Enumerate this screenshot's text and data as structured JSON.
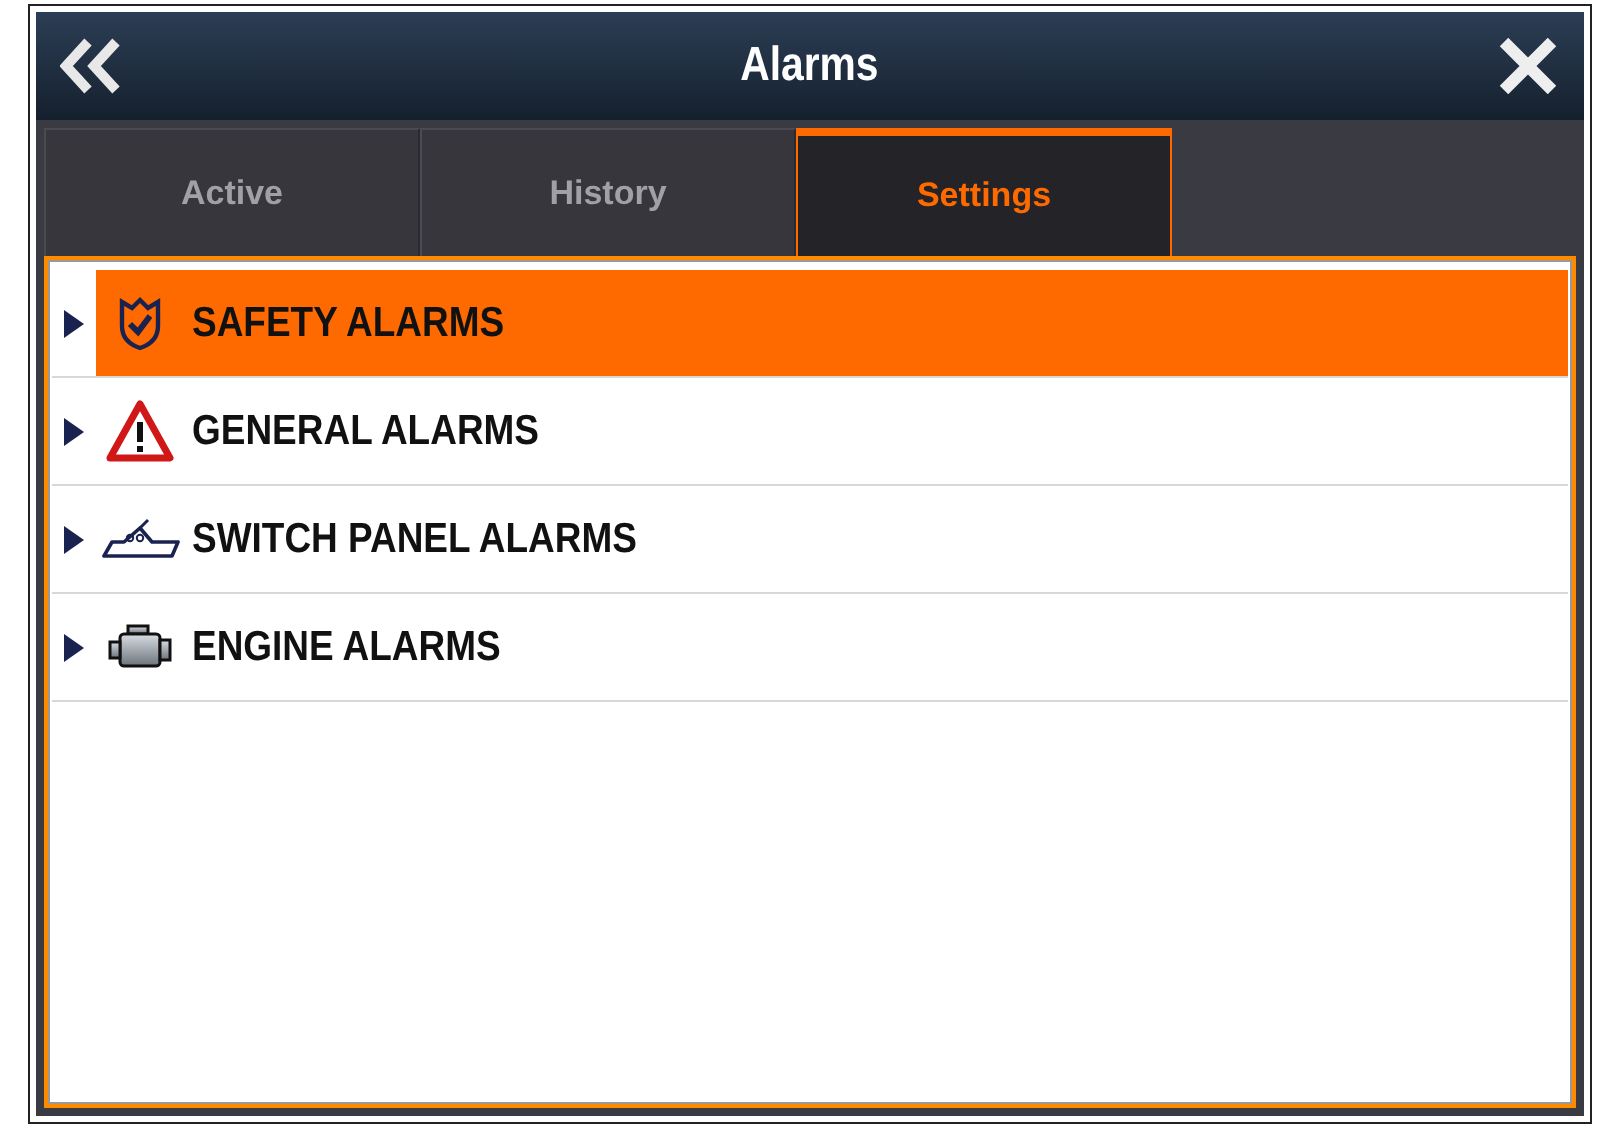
{
  "window": {
    "title": "Alarms"
  },
  "tabs": [
    {
      "label": "Active",
      "selected": false
    },
    {
      "label": "History",
      "selected": false
    },
    {
      "label": "Settings",
      "selected": true
    }
  ],
  "items": [
    {
      "label": "SAFETY ALARMS",
      "kind": "shield",
      "selected": true
    },
    {
      "label": "GENERAL ALARMS",
      "kind": "warning",
      "selected": false
    },
    {
      "label": "SWITCH PANEL ALARMS",
      "kind": "boat",
      "selected": false
    },
    {
      "label": "ENGINE ALARMS",
      "kind": "engine",
      "selected": false
    }
  ]
}
